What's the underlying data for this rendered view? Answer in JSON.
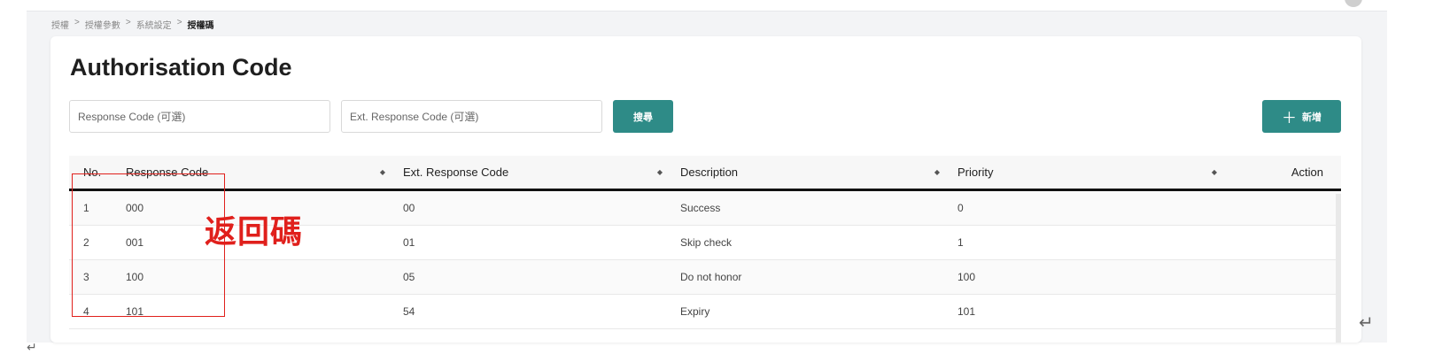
{
  "breadcrumb": {
    "items": [
      "授權",
      "授權參數",
      "系統設定"
    ],
    "separator": ">",
    "current": "授權碼"
  },
  "page": {
    "title": "Authorisation Code"
  },
  "filters": {
    "response_code_placeholder": "Response Code (可選)",
    "ext_response_code_placeholder": "Ext. Response Code (可選)",
    "search_label": "搜尋",
    "add_label": "新增"
  },
  "table": {
    "columns": {
      "no": "No.",
      "response_code": "Response Code",
      "ext_response_code": "Ext. Response Code",
      "description": "Description",
      "priority": "Priority",
      "action": "Action"
    },
    "rows": [
      {
        "no": "1",
        "response_code": "000",
        "ext_response_code": "00",
        "description": "Success",
        "priority": "0"
      },
      {
        "no": "2",
        "response_code": "001",
        "ext_response_code": "01",
        "description": "Skip check",
        "priority": "1"
      },
      {
        "no": "3",
        "response_code": "100",
        "ext_response_code": "05",
        "description": "Do not honor",
        "priority": "100"
      },
      {
        "no": "4",
        "response_code": "101",
        "ext_response_code": "54",
        "description": "Expiry",
        "priority": "101"
      }
    ]
  },
  "annotation": {
    "label": "返回碼",
    "color": "#e0201c"
  },
  "icons": {
    "sort": "sort-icon",
    "add": "plus-icon",
    "return": "return-icon"
  },
  "colors": {
    "accent": "#2e8b87"
  }
}
